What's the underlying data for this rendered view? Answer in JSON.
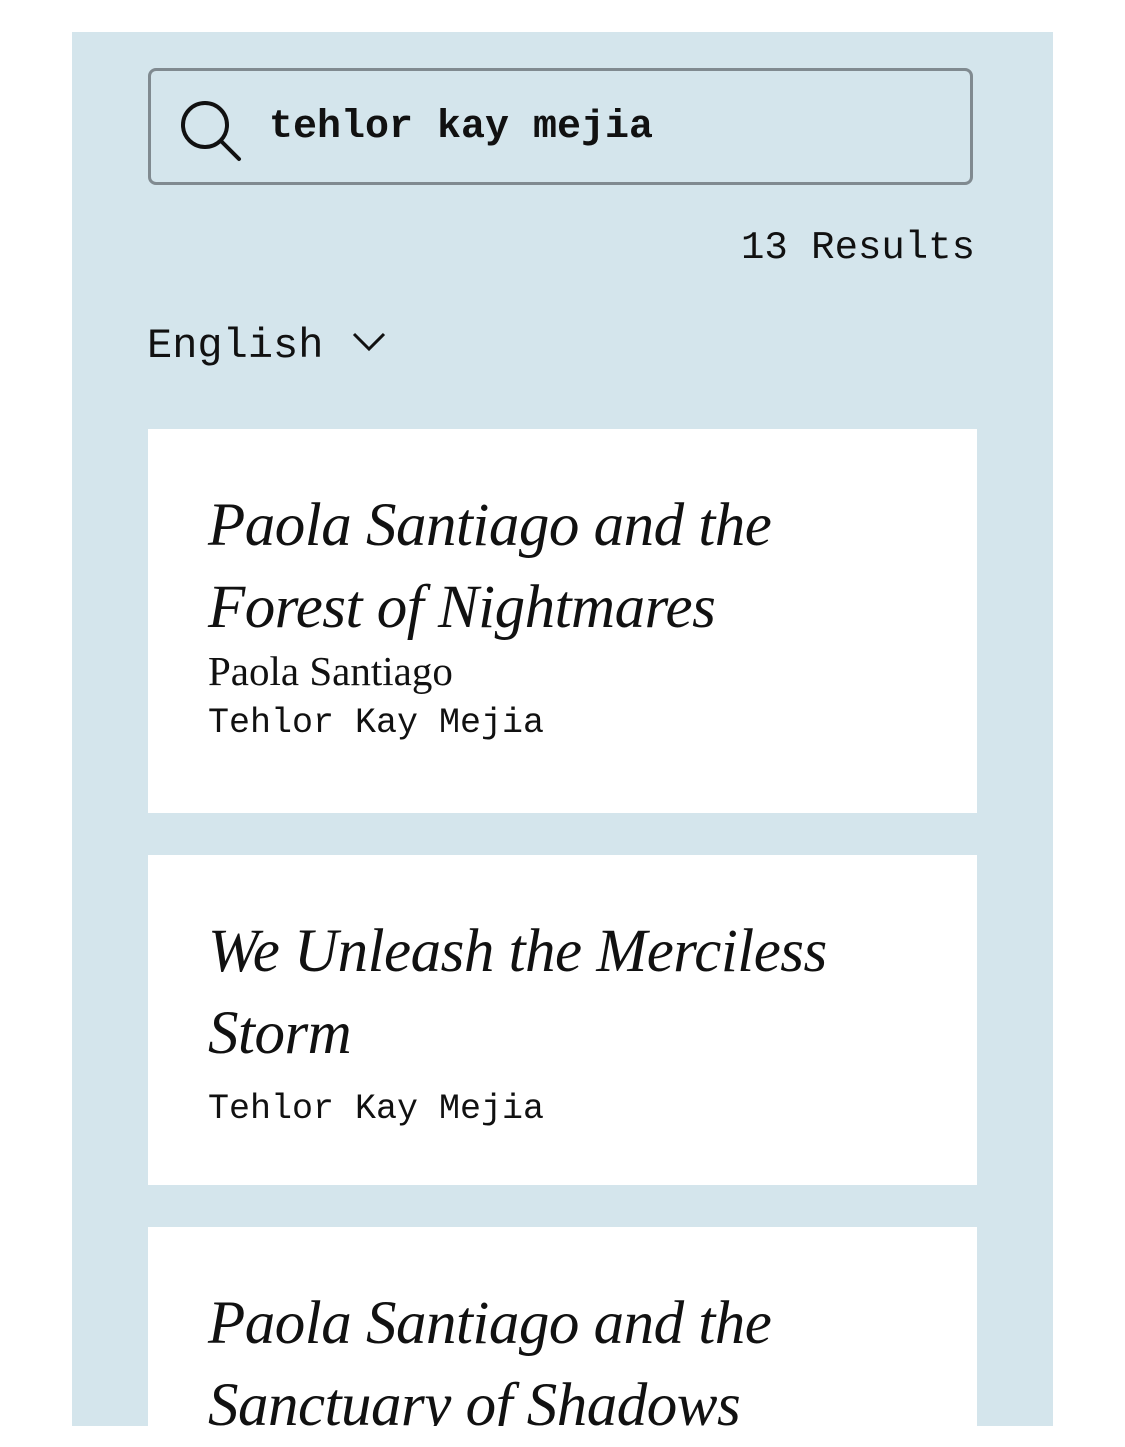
{
  "search": {
    "value": "tehlor kay mejia",
    "icon": "search-icon"
  },
  "results": {
    "count_label": "13 Results"
  },
  "filter": {
    "language": "English",
    "icon": "chevron-down-icon"
  },
  "books": [
    {
      "title": "Paola Santiago and the Forest of Nightmares",
      "series": "Paola Santiago",
      "author": "Tehlor Kay Mejia"
    },
    {
      "title": "We Unleash the Merciless Storm",
      "author": "Tehlor Kay Mejia"
    },
    {
      "title": "Paola Santiago and the Sanctuary of Shadows"
    }
  ],
  "colors": {
    "background": "#d4e5ec",
    "card": "#ffffff",
    "border": "#808a90",
    "text": "#111111"
  }
}
